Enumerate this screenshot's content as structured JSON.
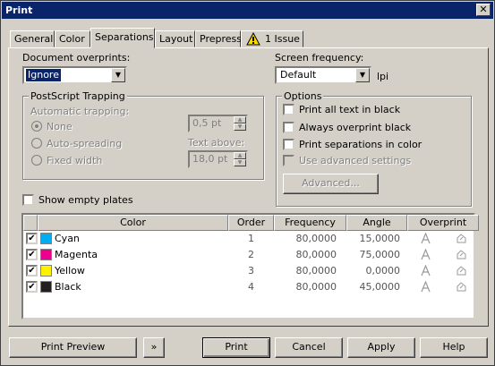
{
  "window": {
    "title": "Print",
    "close": "✕"
  },
  "tabs": [
    {
      "label": "General"
    },
    {
      "label": "Color"
    },
    {
      "label": "Separations"
    },
    {
      "label": "Layout"
    },
    {
      "label": "Prepress"
    },
    {
      "label": "1 Issue"
    }
  ],
  "document_overprints": {
    "label": "Document overprints:",
    "value": "Ignore"
  },
  "screen_frequency": {
    "label": "Screen frequency:",
    "value": "Default",
    "unit": "lpi"
  },
  "trapping": {
    "title": "PostScript Trapping",
    "auto_label": "Automatic trapping:",
    "none": "None",
    "auto_spreading": "Auto-spreading",
    "fixed_width": "Fixed width",
    "width_value": "0,5 pt",
    "text_above_label": "Text above:",
    "text_above_value": "18,0 pt"
  },
  "options": {
    "title": "Options",
    "print_black": "Print all text in black",
    "always_overprint": "Always overprint black",
    "print_color": "Print separations in color",
    "advanced_settings": "Use advanced settings",
    "advanced_button": "Advanced..."
  },
  "show_empty_plates": "Show empty plates",
  "table": {
    "headers": [
      "Color",
      "Order",
      "Frequency",
      "Angle",
      "Overprint"
    ],
    "rows": [
      {
        "name": "Cyan",
        "color": "#00aeef",
        "order": "1",
        "frequency": "80,0000",
        "angle": "15,0000",
        "checked": "✔"
      },
      {
        "name": "Magenta",
        "color": "#ec008c",
        "order": "2",
        "frequency": "80,0000",
        "angle": "75,0000",
        "checked": "✔"
      },
      {
        "name": "Yellow",
        "color": "#fff200",
        "order": "3",
        "frequency": "80,0000",
        "angle": "0,0000",
        "checked": "✔"
      },
      {
        "name": "Black",
        "color": "#231f20",
        "order": "4",
        "frequency": "80,0000",
        "angle": "45,0000",
        "checked": "✔"
      }
    ]
  },
  "buttons": {
    "print_preview": "Print Preview",
    "expand": "»",
    "print": "Print",
    "cancel": "Cancel",
    "apply": "Apply",
    "help": "Help"
  },
  "colors": {
    "titlebar": "#0a246a",
    "face": "#d4d0c8",
    "warning": "#ffd800"
  }
}
